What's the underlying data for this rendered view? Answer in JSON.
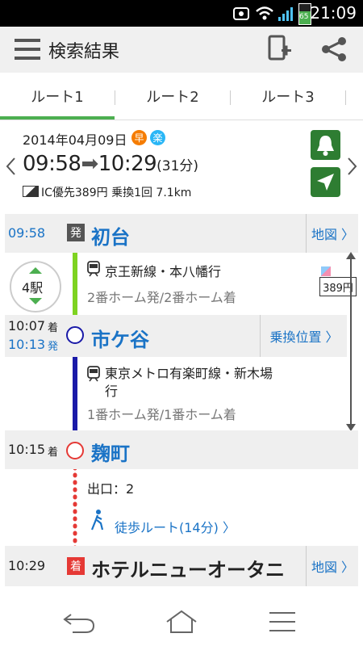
{
  "status_bar": {
    "time": "21:09",
    "battery_percent": "65"
  },
  "app_bar": {
    "title": "検索結果"
  },
  "tabs": [
    "ルート1",
    "ルート2",
    "ルート3"
  ],
  "summary": {
    "date": "2014年04月09日",
    "badge_fast": "早",
    "badge_easy": "楽",
    "depart": "09:58",
    "arrive": "10:29",
    "duration": "(31分)",
    "ic_info": "IC優先389円 乗換1回 7.1km"
  },
  "stations_count": "4駅",
  "fare": "389円",
  "stations": [
    {
      "time": "09:58",
      "tag": "発",
      "name": "初台",
      "link": "地図"
    },
    {
      "time_arr": "10:07",
      "arr_label": "着",
      "time_dep": "10:13",
      "dep_label": "発",
      "name": "市ケ谷",
      "link": "乗換位置"
    },
    {
      "time": "10:15",
      "tag": "着",
      "name": "麹町"
    },
    {
      "time": "10:29",
      "tag": "着",
      "name": "ホテルニューオータニ",
      "link": "地図"
    }
  ],
  "segments": [
    {
      "line": "京王新線・本八幡行",
      "platform": "2番ホーム発/2番ホーム着",
      "color": "#7ed321"
    },
    {
      "line": "東京メトロ有楽町線・新木場行",
      "platform": "1番ホーム発/1番ホーム着",
      "color": "#1a1aa8"
    }
  ],
  "exit": "出口：2",
  "walk_route": "徒歩ルート(14分)",
  "colors": {
    "accent": "#4caf50",
    "link": "#1a73c6",
    "walk": "#e53935",
    "green_button": "#2e7d32"
  }
}
